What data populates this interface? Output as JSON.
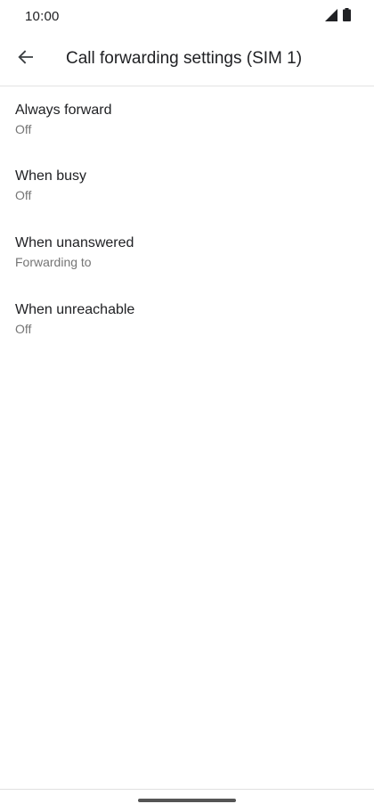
{
  "status_bar": {
    "time": "10:00",
    "icons": [
      "signal-icon",
      "battery-icon"
    ]
  },
  "app_bar": {
    "back_icon": "arrow-back-icon",
    "title": "Call forwarding settings (SIM 1)"
  },
  "settings": [
    {
      "title": "Always forward",
      "summary": "Off"
    },
    {
      "title": "When busy",
      "summary": "Off"
    },
    {
      "title": "When unanswered",
      "summary": "Forwarding to"
    },
    {
      "title": "When unreachable",
      "summary": "Off"
    }
  ],
  "nav_bar": {
    "handle": "home-gesture-handle"
  },
  "colors": {
    "text_primary": "#202124",
    "text_secondary": "#757575",
    "divider": "#e3e3e3"
  }
}
